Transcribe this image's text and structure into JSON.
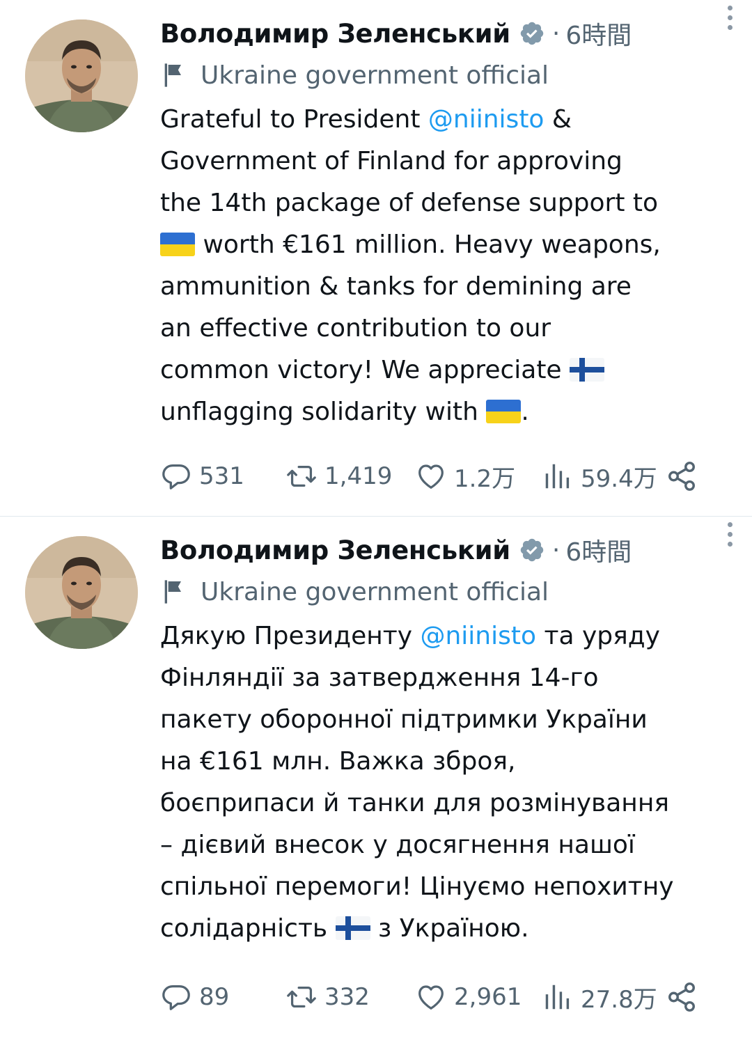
{
  "tweets": [
    {
      "author": "Володимир Зеленський",
      "separator": "·",
      "time": "6時間",
      "label": "Ukraine government official",
      "text": {
        "l1a": "Grateful to President ",
        "l1m": "@niinisto",
        "l1b": " &",
        "l2": "Government of Finland for approving",
        "l3": "the 14th package of defense support to",
        "l4b": " worth €161 million. Heavy weapons,",
        "l5": "ammunition & tanks for demining are",
        "l6": "an effective contribution to our",
        "l7a": "common victory! We appreciate ",
        "l8a": "unflagging solidarity with ",
        "l8b": "."
      },
      "stats": {
        "replies": "531",
        "retweets": "1,419",
        "likes": "1.2万",
        "views": "59.4万"
      }
    },
    {
      "author": "Володимир Зеленський",
      "separator": "·",
      "time": "6時間",
      "label": "Ukraine government official",
      "text": {
        "l1a": "Дякую Президенту ",
        "l1m": "@niinisto",
        "l1b": " та уряду",
        "l2": "Фінляндії за затвердження 14-го",
        "l3": "пакету оборонної підтримки України",
        "l4": "на €161 млн. Важка зброя,",
        "l5": "боєприпаси й танки для розмінування",
        "l6": "– дієвий внесок у досягнення нашої",
        "l7": "спільної перемоги! Цінуємо непохитну",
        "l8a": "солідарність ",
        "l8b": " з Україною."
      },
      "stats": {
        "replies": "89",
        "retweets": "332",
        "likes": "2,961",
        "views": "27.8万"
      }
    }
  ],
  "colors": {
    "accent": "#1d9bf0",
    "secondary_text": "#536471",
    "verified": "#829aab"
  },
  "icons": [
    "verified-badge-icon",
    "more-options-icon",
    "government-flag-icon",
    "reply-icon",
    "retweet-icon",
    "like-icon",
    "views-icon",
    "share-icon",
    "ukraine-flag-emoji",
    "finland-flag-emoji"
  ]
}
